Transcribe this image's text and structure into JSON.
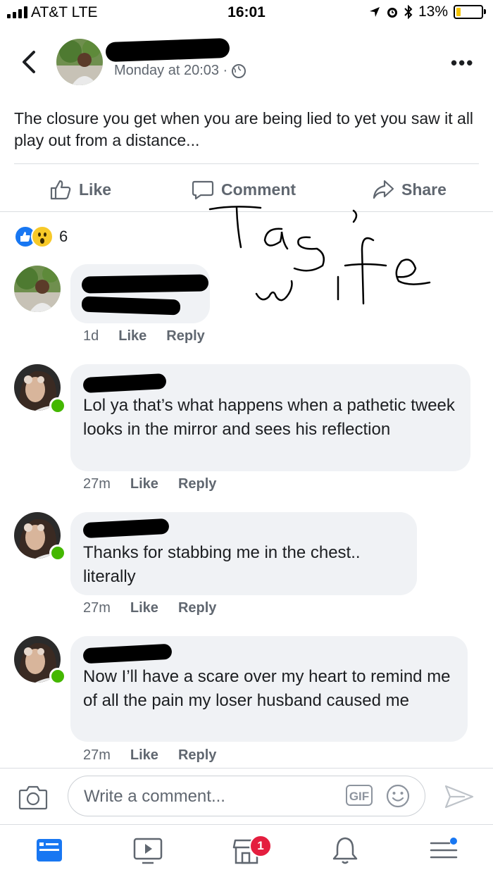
{
  "status_bar": {
    "carrier": "AT&T  LTE",
    "time": "16:01",
    "battery": "13%",
    "battery_level": 0.13,
    "battery_color": "#f5c400"
  },
  "post": {
    "timestamp": "Monday at 20:03 ·",
    "text": "The closure you get when you are being lied to yet you saw it all play out from a distance...",
    "privacy_icon": "globe-icon"
  },
  "actions": {
    "like": "Like",
    "comment": "Comment",
    "share": "Share"
  },
  "reactions": {
    "count": "6",
    "icons": [
      "like-reaction-icon",
      "wow-reaction-icon"
    ]
  },
  "annotation": {
    "line1": "Tag's",
    "line2": "wife"
  },
  "comments": [
    {
      "name_fragment": "H",
      "text": "",
      "time": "1d",
      "like": "Like",
      "reply": "Reply"
    },
    {
      "name_fragment": "H",
      "text": "Lol ya that’s what happens when a pathetic tweek looks in the mirror and sees his reflection",
      "time": "27m",
      "like": "Like",
      "reply": "Reply"
    },
    {
      "name_fragment": "H",
      "text": "Thanks for stabbing me in the chest.. literally",
      "time": "27m",
      "like": "Like",
      "reply": "Reply"
    },
    {
      "name_fragment": "H",
      "text": "Now I’ll have a scare over my heart to remind me of all the pain my loser husband caused me",
      "time": "27m",
      "like": "Like",
      "reply": "Reply"
    }
  ],
  "composer": {
    "placeholder": "Write a comment...",
    "gif_label": "GIF"
  },
  "tabbar": {
    "marketplace_badge": "1"
  },
  "colors": {
    "brand": "#1877f2",
    "online": "#44b700",
    "badge": "#e41e3f",
    "bubble": "#f0f2f5"
  }
}
